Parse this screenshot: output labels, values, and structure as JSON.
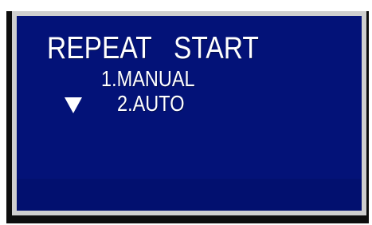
{
  "menu": {
    "title": "REPEAT   START",
    "options": [
      {
        "label": "1.MANUAL"
      },
      {
        "label": "2.AUTO",
        "selected": true
      }
    ],
    "cursor_icon": "down-triangle-icon"
  },
  "colors": {
    "screen_background": "#031278",
    "text": "#ffffff",
    "bezel": "#cfcfcf",
    "device_frame": "#0d0d0d"
  }
}
